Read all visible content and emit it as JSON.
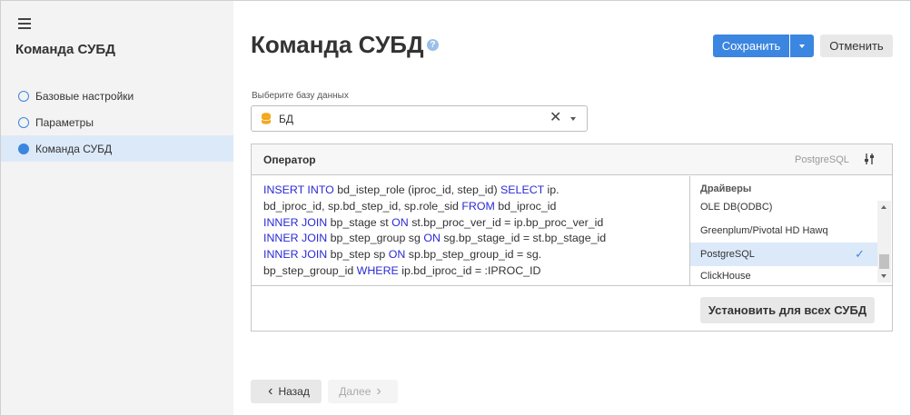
{
  "sidebar": {
    "title": "Команда СУБД",
    "items": [
      {
        "label": "Базовые настройки",
        "active": false
      },
      {
        "label": "Параметры",
        "active": false
      },
      {
        "label": "Команда СУБД",
        "active": true
      }
    ]
  },
  "page": {
    "title": "Команда СУБД",
    "help_icon": "?"
  },
  "toolbar": {
    "save_label": "Сохранить",
    "cancel_label": "Отменить"
  },
  "db_select": {
    "label": "Выберите базу данных",
    "value": "БД"
  },
  "operator": {
    "title": "Оператор",
    "dialect": "PostgreSQL",
    "code_lines": [
      [
        {
          "t": "INSERT INTO",
          "k": true
        },
        {
          "t": " bd_istep_role (iproc_id, step_id) ",
          "k": false
        },
        {
          "t": "SELECT",
          "k": true
        },
        {
          "t": " ip.",
          "k": false
        }
      ],
      [
        {
          "t": "bd_iproc_id, sp.bd_step_id, sp.role_sid ",
          "k": false
        },
        {
          "t": "FROM",
          "k": true
        },
        {
          "t": " bd_iproc_id",
          "k": false
        }
      ],
      [
        {
          "t": "INNER JOIN",
          "k": true
        },
        {
          "t": " bp_stage st ",
          "k": false
        },
        {
          "t": "ON",
          "k": true
        },
        {
          "t": " st.bp_proc_ver_id = ip.bp_proc_ver_id",
          "k": false
        }
      ],
      [
        {
          "t": "INNER JOIN",
          "k": true
        },
        {
          "t": " bp_step_group sg ",
          "k": false
        },
        {
          "t": "ON",
          "k": true
        },
        {
          "t": " sg.bp_stage_id = st.bp_stage_id",
          "k": false
        }
      ],
      [
        {
          "t": "INNER JOIN",
          "k": true
        },
        {
          "t": " bp_step sp ",
          "k": false
        },
        {
          "t": "ON",
          "k": true
        },
        {
          "t": " sp.bp_step_group_id = sg.",
          "k": false
        }
      ],
      [
        {
          "t": "bp_step_group_id ",
          "k": false
        },
        {
          "t": "WHERE",
          "k": true
        },
        {
          "t": " ip.bd_iproc_id = :IPROC_ID",
          "k": false
        }
      ]
    ],
    "drivers": {
      "title": "Драйверы",
      "items": [
        {
          "label": "OLE DB(ODBC)",
          "selected": false
        },
        {
          "label": "Greenplum/Pivotal HD Hawq",
          "selected": false
        },
        {
          "label": "PostgreSQL",
          "selected": true
        },
        {
          "label": "ClickHouse",
          "selected": false
        }
      ]
    },
    "apply_label": "Установить для всех СУБД"
  },
  "nav": {
    "back_label": "Назад",
    "next_label": "Далее"
  },
  "colors": {
    "accent": "#3b86e0",
    "selected_bg": "#dce9f9",
    "keyword": "#2a2ad6"
  }
}
